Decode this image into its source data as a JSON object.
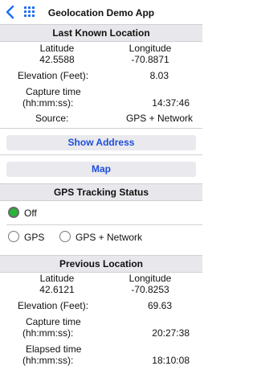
{
  "nav": {
    "title": "Geolocation Demo App",
    "back_icon": "chevron-left-icon",
    "grid_icon": "grid-icon"
  },
  "last_known": {
    "header": "Last Known Location",
    "latitude_label": "Latitude",
    "longitude_label": "Longitude",
    "latitude": "42.5588",
    "longitude": "-70.8871",
    "elevation_label": "Elevation (Feet):",
    "elevation": "8.03",
    "capture_label_1": "Capture time",
    "capture_label_2": "(hh:mm:ss):",
    "capture_time": "14:37:46",
    "source_label": "Source:",
    "source": "GPS + Network"
  },
  "buttons": {
    "show_address": "Show Address",
    "map": "Map"
  },
  "tracking": {
    "header": "GPS Tracking Status",
    "options": [
      "Off",
      "GPS",
      "GPS + Network"
    ],
    "selected": "Off",
    "selected_color": "#2bb43a"
  },
  "previous": {
    "header": "Previous Location",
    "latitude_label": "Latitude",
    "longitude_label": "Longitude",
    "latitude": "42.6121",
    "longitude": "-70.8253",
    "elevation_label": "Elevation (Feet):",
    "elevation": "69.63",
    "capture_label_1": "Capture time",
    "capture_label_2": "(hh:mm:ss):",
    "capture_time": "20:27:38",
    "elapsed_label_1": "Elapsed time",
    "elapsed_label_2": "(hh:mm:ss):",
    "elapsed_time": "18:10:08"
  },
  "colors": {
    "accent": "#1e6ff0",
    "button_text": "#1d4fd8",
    "header_bg": "#e8e8ec"
  }
}
